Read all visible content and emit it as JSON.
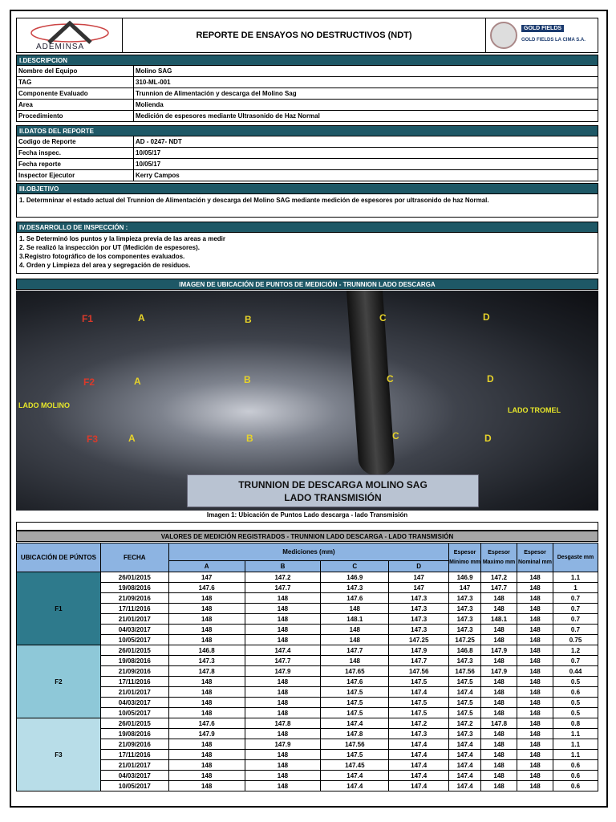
{
  "header": {
    "title": "REPORTE DE  ENSAYOS NO DESTRUCTIVOS (NDT)",
    "left_logo": "ADEMINSA",
    "right_logo": "GOLD FIELDS",
    "right_logo_sub": "GOLD FIELDS LA CIMA S.A."
  },
  "descripcion": {
    "title": "I.DESCRIPCION",
    "rows": [
      {
        "k": "Nombre del Equipo",
        "v": "Molino SAG"
      },
      {
        "k": "TAG",
        "v": "310-ML-001"
      },
      {
        "k": "Componente Evaluado",
        "v": "Trunnion de Alimentación y descarga del Molino Sag"
      },
      {
        "k": "Area",
        "v": "Molienda"
      },
      {
        "k": "Procedimiento",
        "v": "Medición de espesores mediante Ultrasonido de Haz Normal"
      }
    ]
  },
  "datos": {
    "title": "II.DATOS DEL REPORTE",
    "rows": [
      {
        "k": "Codigo de Reporte",
        "v": "AD - 0247- NDT"
      },
      {
        "k": "Fecha inspec.",
        "v": "10/05/17"
      },
      {
        "k": "Fecha reporte",
        "v": "10/05/17"
      },
      {
        "k": "Inspector Ejecutor",
        "v": "Kerry Campos"
      }
    ]
  },
  "objetivo": {
    "title": "III.OBJETIVO",
    "text": "1. Determninar el estado actual del Trunnion de Alimentación y descarga del Molino SAG  mediante medición de espesores por ultrasonido de haz Normal."
  },
  "desarrollo": {
    "title": "IV.DESARROLLO  DE  INSPECCIÓN :",
    "items": [
      "1. Se Determinó los puntos y la limpieza previa de las areas a medir",
      "2. Se realizó la inspección por UT (Medición de espesores).",
      "3.Registro fotográfico de los componentes evaluados.",
      "4. Orden y Limpieza del area y segregación de residuos."
    ]
  },
  "imagen": {
    "title": "IMAGEN  DE UBICACIÓN DE PUNTOS DE MEDICIÓN - TRUNNION LADO DESCARGA",
    "left_side": "LADO MOLINO",
    "right_side": "LADO TROMEL",
    "banner_line1": "TRUNNION  DE DESCARGA MOLINO SAG",
    "banner_line2": "LADO TRANSMISIÓN",
    "caption": "Imagen 1: Ubicación de Puntos Lado descarga  - lado Transmisión",
    "rows": [
      "F1",
      "F2",
      "F3"
    ],
    "points": [
      "A",
      "B",
      "C",
      "D"
    ]
  },
  "tabla": {
    "title": "VALORES DE MEDICIÓN REGISTRADOS - TRUNNION LADO DESCARGA - LADO TRANSMISIÓN",
    "headers": {
      "ubicacion": "UBICACIÓN DE PÚNTOS",
      "fecha": "FECHA",
      "mediciones": "Mediciones (mm)",
      "a": "A",
      "b": "B",
      "c": "C",
      "d": "D",
      "min": "Espesor Minimo mm",
      "max": "Espesor Maximo mm",
      "nom": "Espesor Nominal mm",
      "desg": "Desgaste mm"
    },
    "colors": {
      "F1": "#2e7a8c",
      "F2": "#8ec8d8",
      "F3": "#b8dde8"
    },
    "groups": [
      {
        "name": "F1",
        "rows": [
          [
            "26/01/2015",
            "147",
            "147.2",
            "146.9",
            "147",
            "146.9",
            "147.2",
            "148",
            "1.1"
          ],
          [
            "19/08/2016",
            "147.6",
            "147.7",
            "147.3",
            "147",
            "147",
            "147.7",
            "148",
            "1"
          ],
          [
            "21/09/2016",
            "148",
            "148",
            "147.6",
            "147.3",
            "147.3",
            "148",
            "148",
            "0.7"
          ],
          [
            "17/11/2016",
            "148",
            "148",
            "148",
            "147.3",
            "147.3",
            "148",
            "148",
            "0.7"
          ],
          [
            "21/01/2017",
            "148",
            "148",
            "148.1",
            "147.3",
            "147.3",
            "148.1",
            "148",
            "0.7"
          ],
          [
            "04/03/2017",
            "148",
            "148",
            "148",
            "147.3",
            "147.3",
            "148",
            "148",
            "0.7"
          ],
          [
            "10/05/2017",
            "148",
            "148",
            "148",
            "147.25",
            "147.25",
            "148",
            "148",
            "0.75"
          ]
        ]
      },
      {
        "name": "F2",
        "rows": [
          [
            "26/01/2015",
            "146.8",
            "147.4",
            "147.7",
            "147.9",
            "146.8",
            "147.9",
            "148",
            "1.2"
          ],
          [
            "19/08/2016",
            "147.3",
            "147.7",
            "148",
            "147.7",
            "147.3",
            "148",
            "148",
            "0.7"
          ],
          [
            "21/09/2016",
            "147.8",
            "147.9",
            "147.65",
            "147.56",
            "147.56",
            "147.9",
            "148",
            "0.44"
          ],
          [
            "17/11/2016",
            "148",
            "148",
            "147.6",
            "147.5",
            "147.5",
            "148",
            "148",
            "0.5"
          ],
          [
            "21/01/2017",
            "148",
            "148",
            "147.5",
            "147.4",
            "147.4",
            "148",
            "148",
            "0.6"
          ],
          [
            "04/03/2017",
            "148",
            "148",
            "147.5",
            "147.5",
            "147.5",
            "148",
            "148",
            "0.5"
          ],
          [
            "10/05/2017",
            "148",
            "148",
            "147.5",
            "147.5",
            "147.5",
            "148",
            "148",
            "0.5"
          ]
        ]
      },
      {
        "name": "F3",
        "rows": [
          [
            "26/01/2015",
            "147.6",
            "147.8",
            "147.4",
            "147.2",
            "147.2",
            "147.8",
            "148",
            "0.8"
          ],
          [
            "19/08/2016",
            "147.9",
            "148",
            "147.8",
            "147.3",
            "147.3",
            "148",
            "148",
            "1.1"
          ],
          [
            "21/09/2016",
            "148",
            "147.9",
            "147.56",
            "147.4",
            "147.4",
            "148",
            "148",
            "1.1"
          ],
          [
            "17/11/2016",
            "148",
            "148",
            "147.5",
            "147.4",
            "147.4",
            "148",
            "148",
            "1.1"
          ],
          [
            "21/01/2017",
            "148",
            "148",
            "147.45",
            "147.4",
            "147.4",
            "148",
            "148",
            "0.6"
          ],
          [
            "04/03/2017",
            "148",
            "148",
            "147.4",
            "147.4",
            "147.4",
            "148",
            "148",
            "0.6"
          ],
          [
            "10/05/2017",
            "148",
            "148",
            "147.4",
            "147.4",
            "147.4",
            "148",
            "148",
            "0.6"
          ]
        ]
      }
    ]
  }
}
